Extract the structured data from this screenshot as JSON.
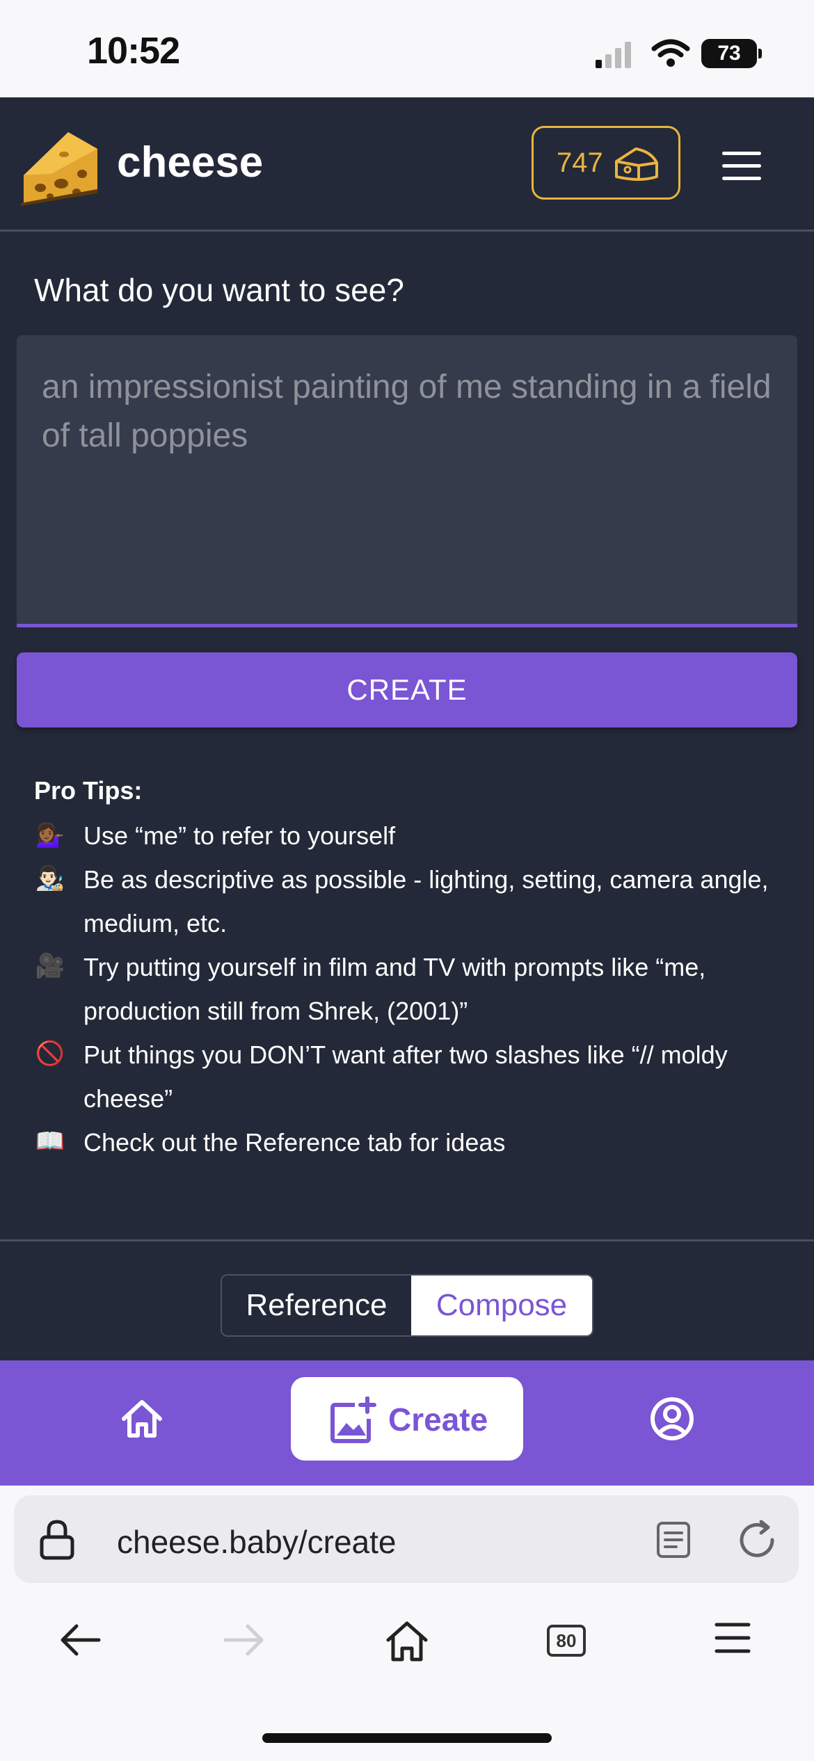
{
  "status_bar": {
    "time": "10:52",
    "battery": "73"
  },
  "header": {
    "brand": "cheese",
    "credits": "747",
    "credits_icon": "cheese-wedge-icon",
    "menu_icon": "hamburger-menu-icon"
  },
  "form": {
    "question": "What do you want to see?",
    "placeholder": "an impressionist painting of me standing in a field of tall poppies",
    "create_label": "CREATE"
  },
  "tips": {
    "title": "Pro Tips:",
    "items": [
      {
        "emoji": "💁🏾‍♀️",
        "text": "Use “me” to refer to yourself"
      },
      {
        "emoji": "👨🏻‍🎨",
        "text": "Be as descriptive as possible - lighting, setting, camera angle, medium, etc."
      },
      {
        "emoji": "🎥",
        "text": "Try putting yourself in film and TV with prompts like “me, production still from Shrek, (2001)”"
      },
      {
        "emoji": "🚫",
        "text": "Put things you DON’T want after two slashes like “// moldy cheese”"
      },
      {
        "emoji": "📖",
        "text": "Check out the Reference tab for ideas"
      }
    ]
  },
  "segmented": {
    "reference": "Reference",
    "compose": "Compose",
    "selected": "Compose"
  },
  "bottom_nav": {
    "home_icon": "home-icon",
    "create_label": "Create",
    "create_icon": "add-image-icon",
    "profile_icon": "profile-icon"
  },
  "browser": {
    "url": "cheese.baby/create",
    "tabs_count": "80"
  },
  "colors": {
    "accent": "#7a55d4",
    "background": "#232938",
    "credits": "#e9b53e"
  }
}
